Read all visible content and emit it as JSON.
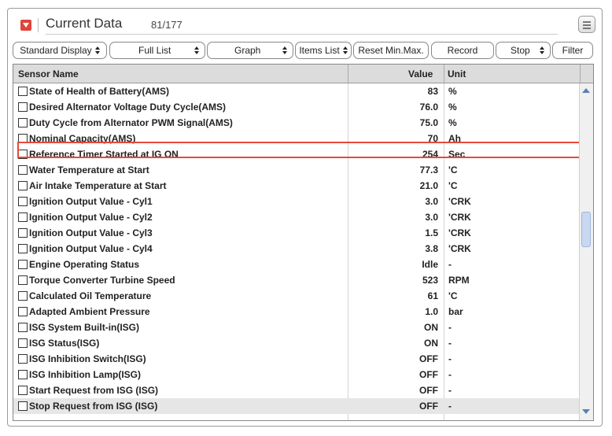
{
  "header": {
    "title": "Current Data",
    "count": "81/177"
  },
  "toolbar": {
    "standard_display": "Standard Display",
    "full_list": "Full List",
    "graph": "Graph",
    "items_list": "Items List",
    "reset": "Reset Min.Max.",
    "record": "Record",
    "stop": "Stop",
    "filter": "Filter"
  },
  "table": {
    "headers": {
      "name": "Sensor Name",
      "value": "Value",
      "unit": "Unit"
    },
    "rows": [
      {
        "name": "State of Health of Battery(AMS)",
        "value": "83",
        "unit": "%"
      },
      {
        "name": "Desired Alternator Voltage Duty Cycle(AMS)",
        "value": "76.0",
        "unit": "%"
      },
      {
        "name": "Duty Cycle from Alternator PWM Signal(AMS)",
        "value": "75.0",
        "unit": "%"
      },
      {
        "name": "Nominal Capacity(AMS)",
        "value": "70",
        "unit": "Ah"
      },
      {
        "name": "Reference Timer Started at IG ON",
        "value": "254",
        "unit": "Sec"
      },
      {
        "name": "Water Temperature at Start",
        "value": "77.3",
        "unit": "'C"
      },
      {
        "name": "Air Intake Temperature at Start",
        "value": "21.0",
        "unit": "'C"
      },
      {
        "name": "Ignition Output Value - Cyl1",
        "value": "3.0",
        "unit": "'CRK"
      },
      {
        "name": "Ignition Output Value - Cyl2",
        "value": "3.0",
        "unit": "'CRK"
      },
      {
        "name": "Ignition Output Value - Cyl3",
        "value": "1.5",
        "unit": "'CRK"
      },
      {
        "name": "Ignition Output Value - Cyl4",
        "value": "3.8",
        "unit": "'CRK"
      },
      {
        "name": "Engine Operating Status",
        "value": "Idle",
        "unit": "-"
      },
      {
        "name": "Torque Converter Turbine Speed",
        "value": "523",
        "unit": "RPM"
      },
      {
        "name": "Calculated Oil Temperature",
        "value": "61",
        "unit": "'C"
      },
      {
        "name": "Adapted Ambient Pressure",
        "value": "1.0",
        "unit": "bar"
      },
      {
        "name": "ISG System Built-in(ISG)",
        "value": "ON",
        "unit": "-"
      },
      {
        "name": "ISG Status(ISG)",
        "value": "ON",
        "unit": "-"
      },
      {
        "name": "ISG Inhibition Switch(ISG)",
        "value": "OFF",
        "unit": "-"
      },
      {
        "name": "ISG Inhibition Lamp(ISG)",
        "value": "OFF",
        "unit": "-"
      },
      {
        "name": "Start Request from ISG (ISG)",
        "value": "OFF",
        "unit": "-"
      },
      {
        "name": "Stop Request from ISG (ISG)",
        "value": "OFF",
        "unit": "-"
      }
    ]
  },
  "colors": {
    "highlight": "#e8493a",
    "collapse": "#e0443a"
  }
}
